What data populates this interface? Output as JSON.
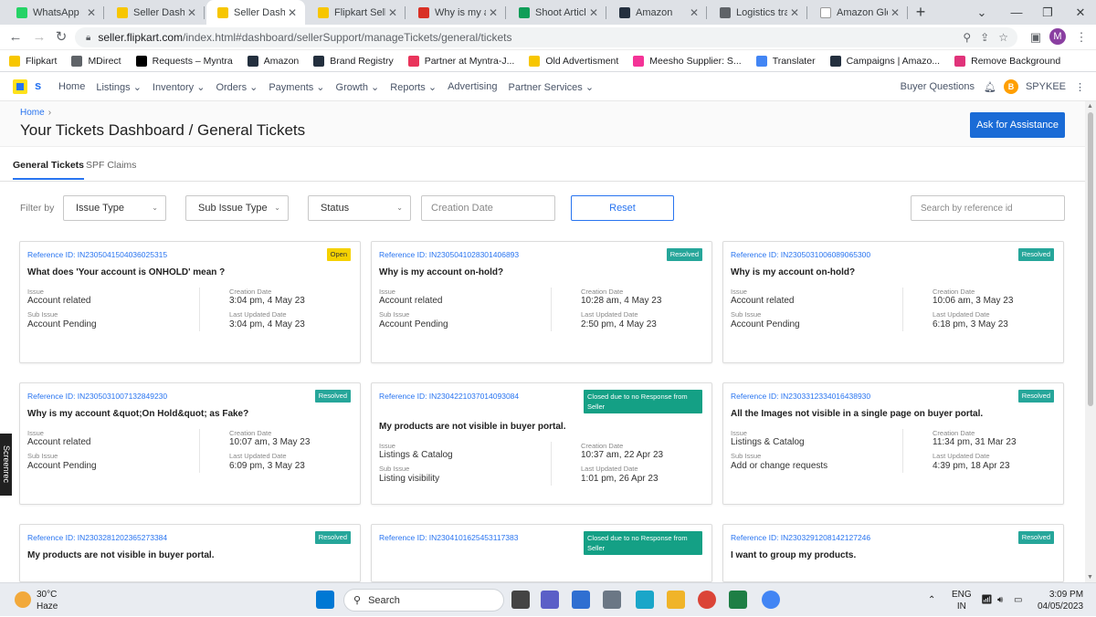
{
  "browser": {
    "tabs": [
      {
        "label": "WhatsApp",
        "icon": "whatsapp-icon",
        "color": "#25d366",
        "active": false
      },
      {
        "label": "Seller Dashbo",
        "icon": "flipkart-icon",
        "color": "#f7c600",
        "active": false
      },
      {
        "label": "Seller Dashbo",
        "icon": "flipkart-icon",
        "color": "#f7c600",
        "active": true
      },
      {
        "label": "Flipkart Seller",
        "icon": "flipkart-icon",
        "color": "#f7c600",
        "active": false
      },
      {
        "label": "Why is my acc",
        "icon": "gmail-icon",
        "color": "#d93025",
        "active": false
      },
      {
        "label": "Shoot Articles",
        "icon": "sheets-icon",
        "color": "#0f9d58",
        "active": false
      },
      {
        "label": "Amazon",
        "icon": "amazon-icon",
        "color": "#232f3e",
        "active": false
      },
      {
        "label": "Logistics track",
        "icon": "globe-icon",
        "color": "#5f6368",
        "active": false
      },
      {
        "label": "Amazon Glob",
        "icon": "amazon-icon",
        "color": "#ffffff",
        "active": false
      }
    ],
    "url_host": "seller.flipkart.com",
    "url_path": "/index.html#dashboard/sellerSupport/manageTickets/general/tickets",
    "profile_initial": "M",
    "bookmarks": [
      {
        "label": "Flipkart",
        "icon": "flipkart-icon",
        "color": "#f7c600"
      },
      {
        "label": "MDirect",
        "icon": "globe-icon",
        "color": "#5f6368"
      },
      {
        "label": "Requests – Myntra",
        "icon": "plus-icon",
        "color": "#000000"
      },
      {
        "label": "Amazon",
        "icon": "amazon-icon",
        "color": "#232f3e"
      },
      {
        "label": "Brand Registry",
        "icon": "amazon-icon",
        "color": "#232f3e"
      },
      {
        "label": "Partner at Myntra-J...",
        "icon": "myntra-icon",
        "color": "#e9345b"
      },
      {
        "label": "Old Advertisment",
        "icon": "flipkart-icon",
        "color": "#f7c600"
      },
      {
        "label": "Meesho Supplier: S...",
        "icon": "meesho-icon",
        "color": "#f43397"
      },
      {
        "label": "Translater",
        "icon": "google-icon",
        "color": "#4285f4"
      },
      {
        "label": "Campaigns | Amazo...",
        "icon": "amazon-icon",
        "color": "#232f3e"
      },
      {
        "label": "Remove Background",
        "icon": "diamond-icon",
        "color": "#e0337a"
      }
    ]
  },
  "seller_nav": {
    "brand_letter": "s",
    "items": [
      "Home",
      "Listings",
      "Inventory",
      "Orders",
      "Payments",
      "Growth",
      "Reports",
      "Advertising",
      "Partner Services"
    ],
    "dropdown_flags": [
      false,
      true,
      true,
      true,
      true,
      true,
      true,
      false,
      true
    ],
    "buyer_questions": "Buyer Questions",
    "account_initial": "B",
    "account_name": "SPYKEE"
  },
  "page": {
    "breadcrumb": "Home",
    "title": "Your Tickets Dashboard / General Tickets",
    "ask_button": "Ask for Assistance",
    "tabs": [
      "General Tickets",
      "SPF Claims"
    ],
    "filter_label": "Filter by",
    "filters": {
      "issue_type": "Issue Type",
      "sub_issue_type": "Sub Issue Type",
      "status": "Status",
      "creation_date": "Creation Date",
      "reset": "Reset",
      "search_placeholder": "Search by reference id"
    },
    "labels": {
      "ref": "Reference ID:",
      "issue": "Issue",
      "sub_issue": "Sub Issue",
      "creation": "Creation Date",
      "updated": "Last Updated Date"
    }
  },
  "tickets": [
    {
      "ref": "IN2305041504036025315",
      "status": "Open",
      "status_color": "#f5d100",
      "status_text_color": "#333333",
      "question": "What does 'Your account is ONHOLD' mean ?",
      "issue": "Account related",
      "sub_issue": "Account Pending",
      "created": "3:04 pm, 4 May 23",
      "updated": "3:04 pm, 4 May 23"
    },
    {
      "ref": "IN2305041028301406893",
      "status": "Resolved",
      "status_color": "#26a69a",
      "status_text_color": "#ffffff",
      "question": "Why is my account on-hold?",
      "issue": "Account related",
      "sub_issue": "Account Pending",
      "created": "10:28 am, 4 May 23",
      "updated": "2:50 pm, 4 May 23"
    },
    {
      "ref": "IN2305031006089065300",
      "status": "Resolved",
      "status_color": "#26a69a",
      "status_text_color": "#ffffff",
      "question": "Why is my account on-hold?",
      "issue": "Account related",
      "sub_issue": "Account Pending",
      "created": "10:06 am, 3 May 23",
      "updated": "6:18 pm, 3 May 23"
    },
    {
      "ref": "IN2305031007132849230",
      "status": "Resolved",
      "status_color": "#26a69a",
      "status_text_color": "#ffffff",
      "question": "Why is my account &quot;On Hold&quot; as Fake?",
      "issue": "Account related",
      "sub_issue": "Account Pending",
      "created": "10:07 am, 3 May 23",
      "updated": "6:09 pm, 3 May 23"
    },
    {
      "ref": "IN2304221037014093084",
      "status": "Closed due to no Response from Seller",
      "status_color": "#14a085",
      "status_text_color": "#ffffff",
      "question": "My products are not visible in buyer portal.",
      "issue": "Listings & Catalog",
      "sub_issue": "Listing visibility",
      "created": "10:37 am, 22 Apr 23",
      "updated": "1:01 pm, 26 Apr 23"
    },
    {
      "ref": "IN2303312334016438930",
      "status": "Resolved",
      "status_color": "#26a69a",
      "status_text_color": "#ffffff",
      "question": "All the Images not visible in a single page on buyer portal.",
      "issue": "Listings & Catalog",
      "sub_issue": "Add or change requests",
      "created": "11:34 pm, 31 Mar 23",
      "updated": "4:39 pm, 18 Apr 23"
    },
    {
      "ref": "IN2303281202365273384",
      "status": "Resolved",
      "status_color": "#26a69a",
      "status_text_color": "#ffffff",
      "question": "My products are not visible in buyer portal.",
      "issue": "",
      "sub_issue": "",
      "created": "",
      "updated": ""
    },
    {
      "ref": "IN2304101625453117383",
      "status": "Closed due to no Response from Seller",
      "status_color": "#14a085",
      "status_text_color": "#ffffff",
      "question": "",
      "issue": "",
      "sub_issue": "",
      "created": "",
      "updated": ""
    },
    {
      "ref": "IN2303291208142127246",
      "status": "Resolved",
      "status_color": "#26a69a",
      "status_text_color": "#ffffff",
      "question": "I want to group my products.",
      "issue": "",
      "sub_issue": "",
      "created": "",
      "updated": ""
    }
  ],
  "taskbar": {
    "temp": "30°C",
    "weather": "Haze",
    "search": "Search",
    "lang1": "ENG",
    "lang2": "IN",
    "time": "3:09 PM",
    "date": "04/05/2023",
    "side_app": "Screenrec"
  }
}
